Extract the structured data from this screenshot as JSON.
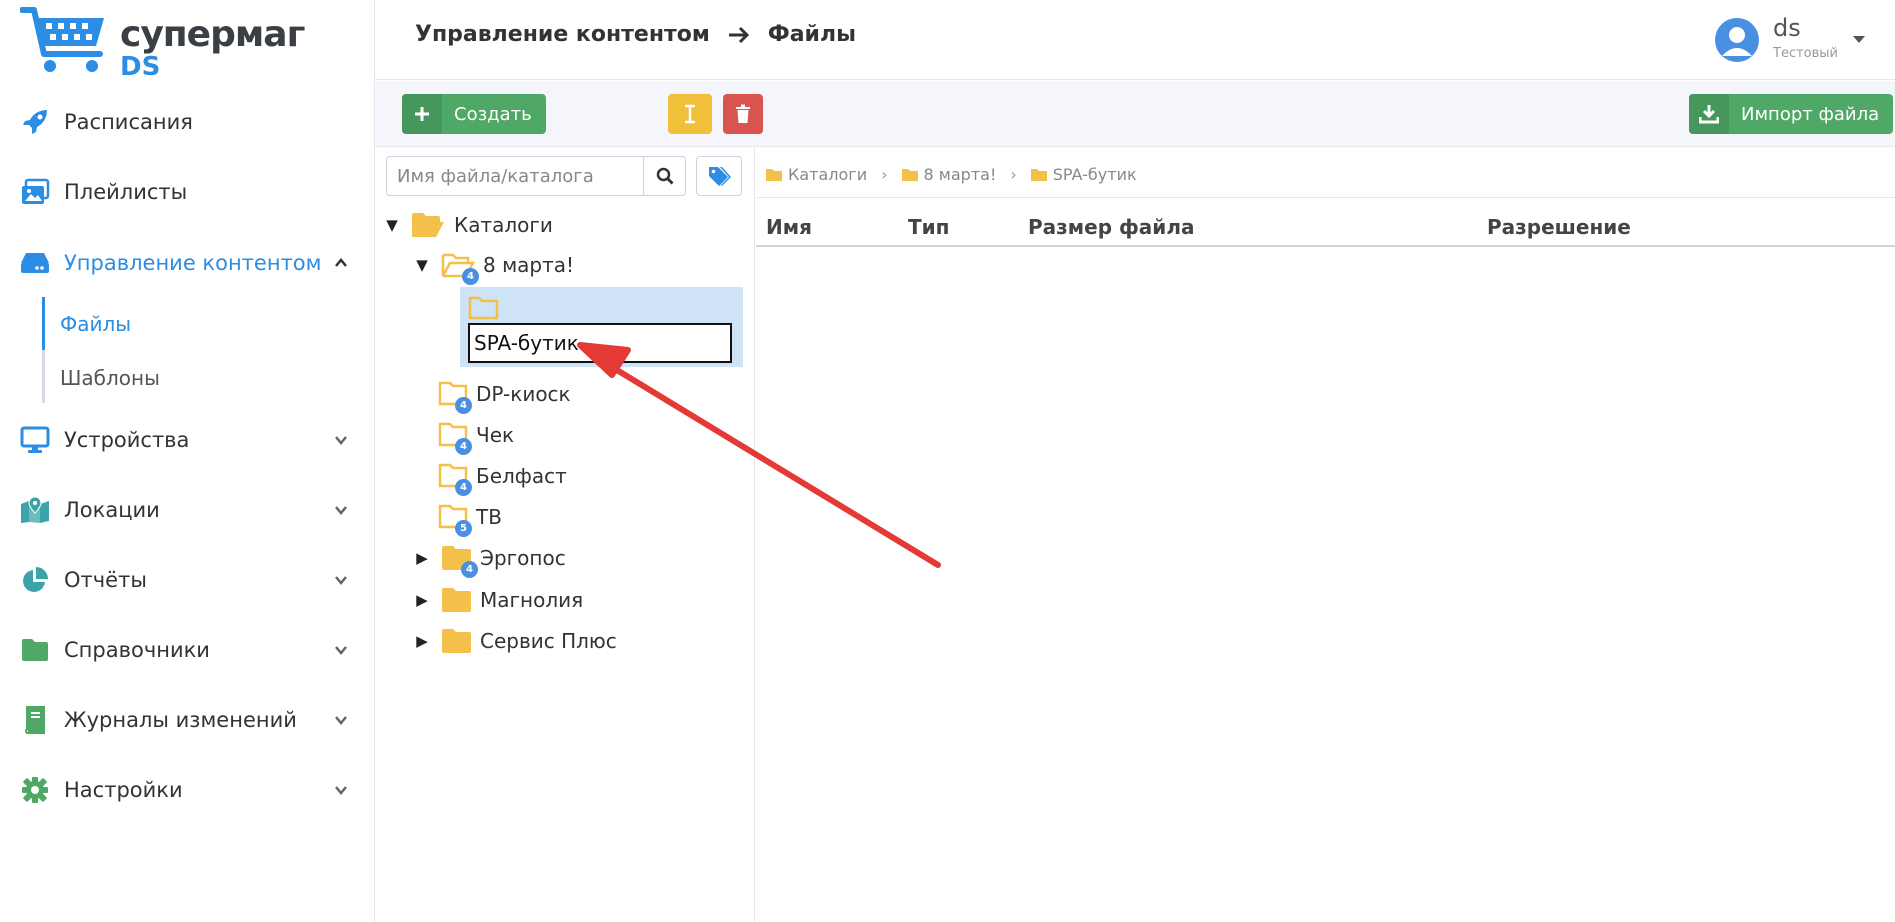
{
  "brand": {
    "line1": "супермаг",
    "line2": "DS",
    "primary": "#2b8de3"
  },
  "sidebar": {
    "items": [
      {
        "key": "schedules",
        "label": "Расписания",
        "icon": "rocket-icon",
        "chevron": false
      },
      {
        "key": "playlists",
        "label": "Плейлисты",
        "icon": "images-icon",
        "chevron": false
      },
      {
        "key": "content",
        "label": "Управление контентом",
        "icon": "drive-icon",
        "chevron": "up",
        "active": true
      },
      {
        "key": "devices",
        "label": "Устройства",
        "icon": "monitor-icon",
        "chevron": "down"
      },
      {
        "key": "locations",
        "label": "Локации",
        "icon": "map-icon",
        "chevron": "down"
      },
      {
        "key": "reports",
        "label": "Отчёты",
        "icon": "pie-chart-icon",
        "chevron": "down"
      },
      {
        "key": "dictionaries",
        "label": "Справочники",
        "icon": "folder-icon",
        "chevron": "down"
      },
      {
        "key": "changelogs",
        "label": "Журналы изменений",
        "icon": "book-icon",
        "chevron": "down"
      },
      {
        "key": "settings",
        "label": "Настройки",
        "icon": "gear-icon",
        "chevron": "down"
      }
    ],
    "subitems": [
      {
        "label": "Файлы",
        "active": true
      },
      {
        "label": "Шаблоны",
        "active": false
      }
    ]
  },
  "header": {
    "breadcrumb": [
      "Управление контентом",
      "Файлы"
    ],
    "user": {
      "name": "ds",
      "role": "Тестовый"
    }
  },
  "toolbar": {
    "create_label": "Создать",
    "import_label": "Импорт файла",
    "colors": {
      "green": "#4fa865",
      "yellow": "#f0c03a",
      "red": "#d9534f"
    }
  },
  "search": {
    "placeholder": "Имя файла/каталога",
    "value": ""
  },
  "tree": {
    "root": "Каталоги",
    "march": {
      "label": "8 марта!",
      "badge": "4"
    },
    "rename_value": "SPA-бутик",
    "children": [
      {
        "label": "DP-киоск",
        "badge": "4"
      },
      {
        "label": "Чек",
        "badge": "4"
      },
      {
        "label": "Белфаст",
        "badge": "4"
      },
      {
        "label": "ТВ",
        "badge": "5"
      }
    ],
    "siblings": [
      {
        "label": "Эргопос",
        "badge": "4"
      },
      {
        "label": "Магнолия",
        "badge": ""
      },
      {
        "label": "Сервис Плюс",
        "badge": ""
      }
    ]
  },
  "path": [
    "Каталоги",
    "8 марта!",
    "SPA-бутик"
  ],
  "table": {
    "columns": [
      "Имя",
      "Тип",
      "Размер файла",
      "Разрешение"
    ]
  },
  "annotation": {
    "color": "#e53935"
  }
}
